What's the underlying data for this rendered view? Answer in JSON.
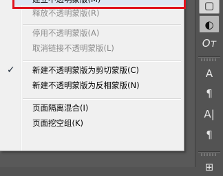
{
  "menu": {
    "clipped_top": "建立不透明蒙版(M)",
    "items": [
      {
        "label": "释放不透明蒙版(R)",
        "disabled": true,
        "checked": false
      },
      {
        "label": "停用不透明蒙版(A)",
        "disabled": true,
        "checked": false
      },
      {
        "label": "取消链接不透明蒙版(L)",
        "disabled": true,
        "checked": false
      },
      {
        "label": "新建不透明蒙版为剪切蒙版(C)",
        "disabled": false,
        "checked": true
      },
      {
        "label": "新建不透明蒙版为反相蒙版(N)",
        "disabled": false,
        "checked": false
      },
      {
        "label": "页面隔离混合(I)",
        "disabled": false,
        "checked": false
      },
      {
        "label": "页面挖空组(K)",
        "disabled": false,
        "checked": false
      }
    ],
    "check_glyph": "✓"
  },
  "panel": {
    "buttons": [
      {
        "name": "color-panel-icon",
        "glyph": "▢"
      },
      {
        "name": "transparency-panel-icon",
        "glyph": "◐"
      },
      {
        "name": "opentype-panel-icon",
        "glyph": "Oᴛ"
      },
      {
        "name": "character-styles-icon",
        "glyph": "A"
      },
      {
        "name": "paragraph-styles-icon",
        "glyph": "¶"
      },
      {
        "name": "character-panel-icon",
        "glyph": "A|"
      },
      {
        "name": "paragraph-panel-icon",
        "glyph": "¶"
      },
      {
        "name": "artboards-panel-icon",
        "glyph": "⊞"
      }
    ]
  },
  "colors": {
    "highlight_border": "#e0141f",
    "menu_bg": "#f0f0f0",
    "panel_bg": "#535353"
  }
}
